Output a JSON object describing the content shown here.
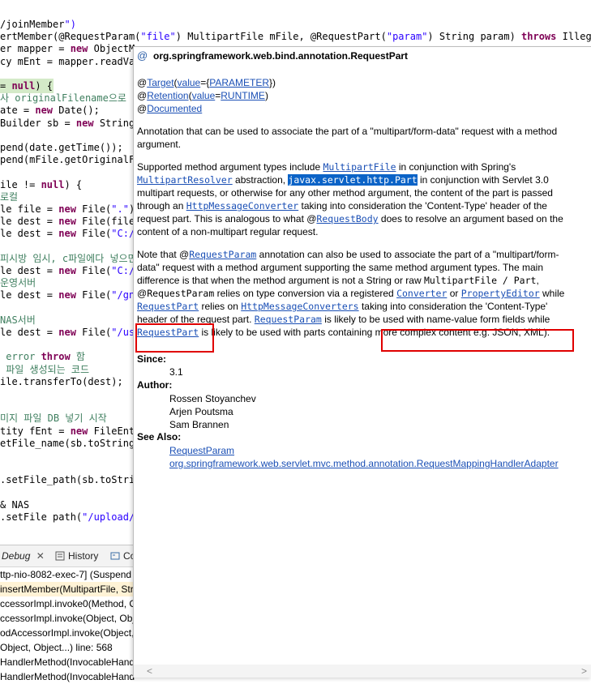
{
  "editor": {
    "lines": [
      "/joinMember\")",
      "ertMember(@RequestParam(\"file\") MultipartFile mFile, @RequestPart(\"param\") String param) throws IllegalSt",
      "er mapper = new ObjectMa",
      "cy mEnt = mapper.readVal",
      "",
      "= null) {",
      "사 originalFilename으로 매",
      "ate = new Date();",
      "Builder sb = new StringB",
      "",
      "pend(date.getTime());",
      "pend(mFile.getOriginalFi",
      "",
      "ile != null) {",
      "로컬",
      "le file = new File(\".\");",
      "le dest = new File(file.",
      "le dest = new File(\"C:/U",
      "",
      "피시방 임시, c파일에다 넣으면 안",
      "le dest = new File(\"C://",
      "운영서버",
      "le dest = new File(\"/gns",
      "",
      "NAS서버",
      "le dest = new File(\"/usr",
      "",
      " error throw 함",
      " 파일 생성되는 코드",
      "ile.transferTo(dest);",
      "",
      "",
      "미지 파일 DB 넣기 시작",
      "tity fEnt = new FileEnti",
      "etFile_name(sb.toString(",
      "",
      "",
      ".setFile_path(sb.toStrin",
      "",
      "& NAS",
      ".setFile path(\"/upload/\""
    ]
  },
  "debug": {
    "tabs": [
      {
        "label": "Debug",
        "icon": "debug-bug-icon"
      },
      {
        "label": "History",
        "icon": "history-icon"
      },
      {
        "label": "Co",
        "icon": "console-icon"
      }
    ],
    "frames": [
      "ttp-nio-8082-exec-7] (Suspend",
      "insertMember(MultipartFile, Str",
      "ccessorImpl.invoke0(Method, O",
      "ccessorImpl.invoke(Object, Obj",
      "odAccessorImpl.invoke(Object,",
      "Object, Object...) line: 568",
      "HandlerMethod(InvocableHand",
      "HandlerMethod(InvocableHand"
    ]
  },
  "javadoc": {
    "title": "org.springframework.web.bind.annotation.RequestPart",
    "annotations": {
      "target_at": "@",
      "target": "Target",
      "target_value_kw": "value",
      "target_value": "PARAMETER",
      "retention_at": "@",
      "retention": "Retention",
      "retention_value_kw": "value",
      "retention_value": "RUNTIME",
      "documented_at": "@",
      "documented": "Documented"
    },
    "desc": "Annotation that can be used to associate the part of a \"multipart/form-data\" request with a method argument.",
    "p2": {
      "a": "Supported method argument types include ",
      "l1": "MultipartFile",
      "b": " in conjunction with Spring's",
      "l2": "MultipartResolver",
      "c": " abstraction, ",
      "sel": "javax.servlet.http.Part",
      "d": " in conjunction with Servlet 3.0",
      "e": "multipart requests, or otherwise for any other method argument, the content of the part is passed",
      "f": "through an ",
      "l3": "HttpMessageConverter",
      "g": " taking into consideration the 'Content-Type' header of the",
      "h": "request part. This is analogous to what @",
      "l4": "RequestBody",
      "i": " does to resolve an argument based on the",
      "j": "content of a non-multipart regular request."
    },
    "p3": {
      "a": "Note that @",
      "l1": "RequestParam",
      "b": " annotation can also be used to associate the part of a \"multipart/form-",
      "c": "data\" request with a method argument supporting the same method argument types. The main",
      "d": "difference is that when the method argument is not a String or raw ",
      "m1": "MultipartFile / Part",
      "e": ",",
      "f": "@",
      "m2": "RequestParam",
      "g": " relies on type conversion via a registered ",
      "l2": "Converter",
      "h": " or ",
      "l3": "PropertyEditor",
      "i": " while",
      "l4": "RequestPart",
      "j": " relies on ",
      "l5": "HttpMessageConverters",
      "k": " taking into consideration the 'Content-Type'",
      "l": "header of the request part. ",
      "l6": "RequestParam",
      "m": " is likely to be used with name-value form fields while",
      "l7": "RequestPart",
      "n": " is likely to be used with parts containing more complex content e.g. JSON, XML)."
    },
    "since_label": "Since:",
    "since": "3.1",
    "author_label": "Author:",
    "authors": [
      "Rossen Stoyanchev",
      "Arjen Poutsma",
      "Sam Brannen"
    ],
    "see_also_label": "See Also:",
    "see_also": [
      "RequestParam",
      "org.springframework.web.servlet.mvc.method.annotation.RequestMappingHandlerAdapter"
    ],
    "at_icon": "@"
  },
  "colors": {
    "keyword": "#7f0055",
    "string": "#2a00ff",
    "comment": "#3f7f5f",
    "link": "#1a4fb5",
    "selection": "#0b63c7",
    "highlight_box": "#e00000"
  }
}
